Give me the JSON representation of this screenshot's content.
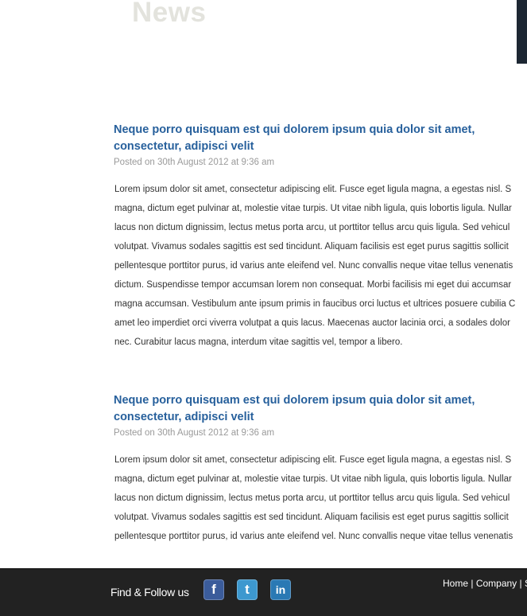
{
  "page": {
    "title": "News"
  },
  "articles": [
    {
      "title_line1": "Neque porro quisquam est qui dolorem ipsum quia dolor sit amet,",
      "title_line2": "consectetur, adipisci velit",
      "date": "Posted on 30th August 2012 at 9:36 am",
      "body_lines": [
        "Lorem ipsum dolor sit amet, consectetur adipiscing elit. Fusce eget ligula magna, a egestas nisl. S",
        "magna, dictum eget pulvinar at, molestie vitae turpis. Ut vitae nibh ligula, quis lobortis ligula. Nullar",
        "lacus non dictum dignissim, lectus metus porta arcu, ut porttitor tellus arcu quis ligula. Sed vehicul",
        "volutpat. Vivamus sodales sagittis est sed tincidunt. Aliquam facilisis est eget purus sagittis sollicit",
        "pellentesque porttitor purus, id varius ante eleifend vel. Nunc convallis neque vitae tellus venenatis",
        "dictum. Suspendisse tempor accumsan lorem non consequat. Morbi facilisis mi eget dui accumsar",
        "magna accumsan. Vestibulum ante ipsum primis in faucibus orci luctus et ultrices posuere cubilia C",
        "amet leo imperdiet orci viverra volutpat a quis lacus. Maecenas auctor lacinia orci, a sodales dolor",
        "nec. Curabitur lacus magna, interdum vitae sagittis vel, tempor a libero."
      ]
    },
    {
      "title_line1": "Neque porro quisquam est qui dolorem ipsum quia dolor sit amet,",
      "title_line2": "consectetur, adipisci velit",
      "date": "Posted on 30th August 2012 at 9:36 am",
      "body_lines": [
        "Lorem ipsum dolor sit amet, consectetur adipiscing elit. Fusce eget ligula magna, a egestas nisl. S",
        "magna, dictum eget pulvinar at, molestie vitae turpis. Ut vitae nibh ligula, quis lobortis ligula. Nullar",
        "lacus non dictum dignissim, lectus metus porta arcu, ut porttitor tellus arcu quis ligula. Sed vehicul",
        "volutpat. Vivamus sodales sagittis est sed tincidunt. Aliquam facilisis est eget purus sagittis sollicit",
        "pellentesque porttitor purus, id varius ante eleifend vel. Nunc convallis neque vitae tellus venenatis"
      ]
    }
  ],
  "footer": {
    "follow_label": "Find & Follow us",
    "social": [
      {
        "icon": "facebook-icon",
        "glyph": "f",
        "color": "#3b5c9b"
      },
      {
        "icon": "twitter-icon",
        "glyph": "t",
        "color": "#3d98cf"
      },
      {
        "icon": "linkedin-icon",
        "glyph": "in",
        "color": "#2a79b4"
      }
    ],
    "nav": [
      {
        "label": "Home"
      },
      {
        "label": "Company"
      },
      {
        "label": "S"
      }
    ],
    "nav_separator": "|"
  },
  "colors": {
    "title_blue": "#27609c",
    "footer_bg": "#222222",
    "heading_faded": "#e3e3dd"
  }
}
